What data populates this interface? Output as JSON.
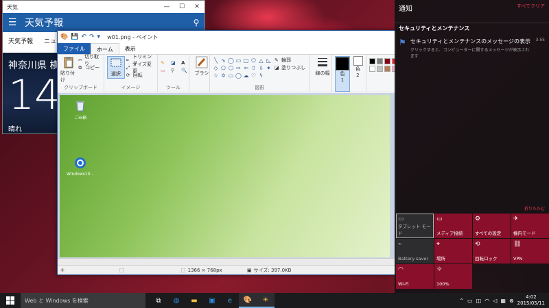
{
  "weather": {
    "window_title": "天気",
    "app_title": "天気予報",
    "nav": [
      "天気予報",
      "ニュース"
    ],
    "city": "神奈川県 横",
    "temperature": "14",
    "condition": "晴れ"
  },
  "paint": {
    "title": "w01.png - ペイント",
    "tabs": {
      "file": "ファイル",
      "home": "ホーム",
      "view": "表示"
    },
    "clipboard": {
      "paste": "貼り付け",
      "cut": "切り取り",
      "copy": "コピー",
      "group": "クリップボード"
    },
    "image": {
      "select": "選択",
      "crop": "トリミング",
      "resize": "サイズ変更",
      "rotate": "回転",
      "group": "イメージ"
    },
    "tools": {
      "group": "ツール"
    },
    "brushes": {
      "label": "ブラシ"
    },
    "shapes": {
      "outline": "輪郭",
      "fill": "塗りつぶし",
      "group": "図形"
    },
    "size": {
      "label": "線の幅"
    },
    "colors": {
      "color1": "色",
      "color1_num": "1",
      "color2": "色",
      "color2_num": "2"
    },
    "desktop_icons": [
      {
        "label": "ごみ箱"
      },
      {
        "label": "Windows10..."
      }
    ],
    "status": {
      "dimensions": "1366 × 768px",
      "size": "サイズ: 397.0KB"
    }
  },
  "action_center": {
    "title": "通知",
    "clear_all": "すべてクリア",
    "section": "セキュリティとメンテナンス",
    "notification": {
      "title": "セキュリティとメンテナンスのメッセージの表示",
      "desc": "クリックすると、コンピューターに関するメッセージが表示されます",
      "time": "3:55"
    },
    "collapse": "折りたたむ",
    "tiles": [
      {
        "label": "タブレット モード",
        "icon": "tablet-icon",
        "state": "off"
      },
      {
        "label": "メディア接続",
        "icon": "connect-icon",
        "state": "on"
      },
      {
        "label": "すべての設定",
        "icon": "gear-icon",
        "state": "on"
      },
      {
        "label": "機内モード",
        "icon": "airplane-icon",
        "state": "on"
      },
      {
        "label": "Battery saver",
        "icon": "battery-icon",
        "state": "off"
      },
      {
        "label": "場所",
        "icon": "location-icon",
        "state": "on"
      },
      {
        "label": "回転ロック",
        "icon": "rotation-lock-icon",
        "state": "on"
      },
      {
        "label": "VPN",
        "icon": "vpn-icon",
        "state": "on"
      },
      {
        "label": "Wi-Fi",
        "icon": "wifi-icon",
        "state": "on"
      },
      {
        "label": "100%",
        "icon": "brightness-icon",
        "state": "on"
      }
    ]
  },
  "taskbar": {
    "search_placeholder": "Web と Windows を検索",
    "time": "4:02",
    "date": "2015/05/11"
  },
  "colors": {
    "accent": "#8a0f2a",
    "taskbar": "#1b1b1d",
    "paint_file_tab": "#1e5eb0"
  }
}
